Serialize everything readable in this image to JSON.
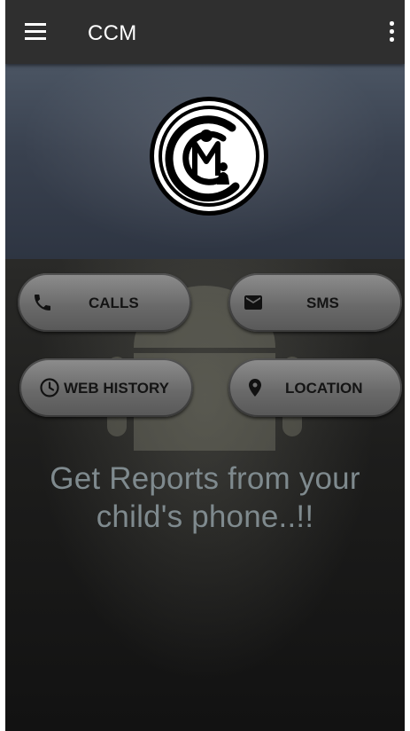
{
  "app_bar": {
    "title": "CCM",
    "menu_icon": "hamburger-menu-icon",
    "overflow_icon": "more-vert-icon",
    "background": "#2f2f2f"
  },
  "header": {
    "logo_icon": "ccm-logo-icon"
  },
  "actions": [
    {
      "label": "CALLS",
      "icon": "phone-icon"
    },
    {
      "label": "SMS",
      "icon": "envelope-icon"
    },
    {
      "label": "WEB HISTORY",
      "icon": "clock-icon"
    },
    {
      "label": "LOCATION",
      "icon": "map-pin-icon"
    }
  ],
  "tagline": {
    "line1": "Get Reports from your",
    "line2": "child's phone..!!",
    "color": "#7f8a8e"
  }
}
